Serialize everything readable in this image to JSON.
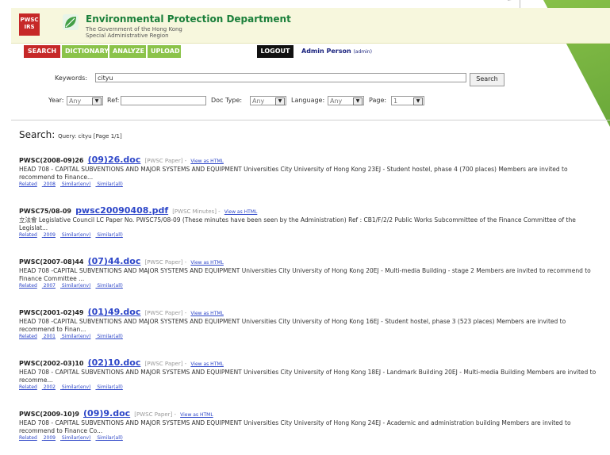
{
  "app": {
    "logo_text": "PWSC IRS",
    "org_title": "Environmental Protection Department",
    "org_sub1": "The Government of the Hong Kong",
    "org_sub2": "Special Administrative Region"
  },
  "nav": {
    "items": [
      "SEARCH",
      "DICTIONARY",
      "ANALYZE",
      "UPLOAD"
    ],
    "logout": "LOGOUT",
    "user": "Admin Person",
    "role": "(admin)"
  },
  "search": {
    "keywords_label": "Keywords:",
    "keywords_value": "cityu",
    "search_button": "Search",
    "year_label": "Year:",
    "year_value": "Any",
    "ref_label": "Ref:",
    "ref_value": "",
    "doctype_label": "Doc Type:",
    "doctype_value": "Any",
    "language_label": "Language:",
    "language_value": "Any",
    "page_label": "Page:",
    "page_value": "1"
  },
  "results_header": {
    "title": "Search:",
    "query": "Query: cityu  [Page 1/1]"
  },
  "results": [
    {
      "id": "PWSC(2008-09)26",
      "link": "(09)26.doc",
      "meta": "[PWSC Paper] -",
      "view": "View as HTML",
      "text": "HEAD 708 - CAPITAL SUBVENTIONS AND MAJOR SYSTEMS AND EQUIPMENT Universities City University of Hong Kong 23EJ - Student hostel, phase 4 (700 places) Members are invited to recommend to Finance...",
      "related": "Related",
      "year": "2008",
      "similar_env": "Similar(env)",
      "similar_all": "Similar(all)"
    },
    {
      "id": "PWSC75/08-09",
      "link": "pwsc20090408.pdf",
      "meta": "[PWSC Minutes] -",
      "view": "View as HTML",
      "text": "立法會 Legislative Council LC Paper No. PWSC75/08-09 (These minutes have been seen by the Administration) Ref : CB1/F/2/2 Public Works Subcommittee of the Finance Committee of the Legislat...",
      "related": "Related",
      "year": "2009",
      "similar_env": "Similar(env)",
      "similar_all": "Similar(all)"
    },
    {
      "id": "PWSC(2007-08)44",
      "link": "(07)44.doc",
      "meta": "[PWSC Paper] -",
      "view": "View as HTML",
      "text": "HEAD 708 -CAPITAL SUBVENTIONS AND MAJOR SYSTEMS AND EQUIPMENT Universities City University of Hong Kong 20EJ - Multi-media Building - stage 2 Members are invited to recommend to Finance Committee ...",
      "related": "Related",
      "year": "2007",
      "similar_env": "Similar(env)",
      "similar_all": "Similar(all)"
    },
    {
      "id": "PWSC(2001-02)49",
      "link": "(01)49.doc",
      "meta": "[PWSC Paper] -",
      "view": "View as HTML",
      "text": "HEAD 708 -CAPITAL SUBVENTIONS AND MAJOR SYSTEMS AND EQUIPMENT Universities City University of Hong Kong 16EJ - Student hostel, phase 3 (523 places) Members are invited to recommend to Finan...",
      "related": "Related",
      "year": "2001",
      "similar_env": "Similar(env)",
      "similar_all": "Similar(all)"
    },
    {
      "id": "PWSC(2002-03)10",
      "link": "(02)10.doc",
      "meta": "[PWSC Paper] -",
      "view": "View as HTML",
      "text": "HEAD 708 - CAPITAL SUBVENTIONS AND MAJOR SYSTEMS AND EQUIPMENT Universities City University of Hong Kong 18EJ - Landmark Building 20EJ - Multi-media Building Members are invited to recomme...",
      "related": "Related",
      "year": "2002",
      "similar_env": "Similar(env)",
      "similar_all": "Similar(all)"
    },
    {
      "id": "PWSC(2009-10)9",
      "link": "(09)9.doc",
      "meta": "[PWSC Paper] -",
      "view": "View as HTML",
      "text": "HEAD 708 - CAPITAL SUBVENTIONS AND MAJOR SYSTEMS AND EQUIPMENT Universities City University of Hong Kong 24EJ - Academic and administration building Members are invited to recommend to Finance Co...",
      "related": "Related",
      "year": "2009",
      "similar_env": "Similar(env)",
      "similar_all": "Similar(all)"
    }
  ],
  "colors": {
    "brand_red": "#c62828",
    "nav_green": "#8bc34a",
    "link_blue": "#2d46c8",
    "header_bg": "#f7f7dd"
  }
}
